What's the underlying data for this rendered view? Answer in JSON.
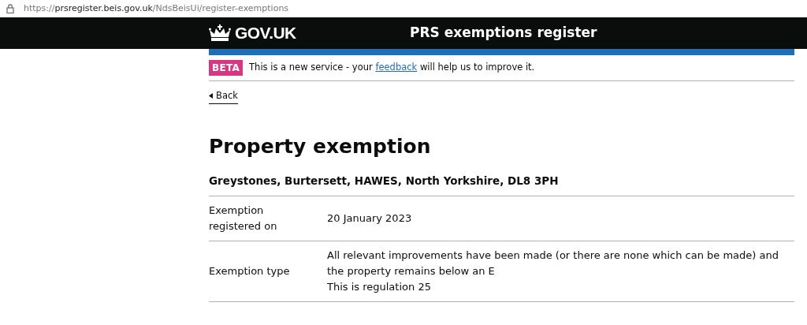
{
  "address_bar": {
    "scheme": "https://",
    "host": "prsregister.beis.gov.uk",
    "path": "/NdsBeisUi/register-exemptions"
  },
  "header": {
    "logo": "GOV.UK",
    "service_name": "PRS exemptions register"
  },
  "phase_banner": {
    "tag": "BETA",
    "text_before": "This is a new service - your",
    "link": "feedback",
    "text_after": "will help us to improve it."
  },
  "back_link": "Back",
  "heading": "Property exemption",
  "address": "Greystones, Burtersett, HAWES, North Yorkshire, DL8 3PH",
  "summary": [
    {
      "key": [
        "Exemption",
        "registered on"
      ],
      "value": [
        "20 January 2023"
      ]
    },
    {
      "key": [
        "Exemption type"
      ],
      "value": [
        "All relevant improvements have been made (or there are none which can be made) and the property remains below an E",
        "This is regulation 25"
      ]
    }
  ]
}
